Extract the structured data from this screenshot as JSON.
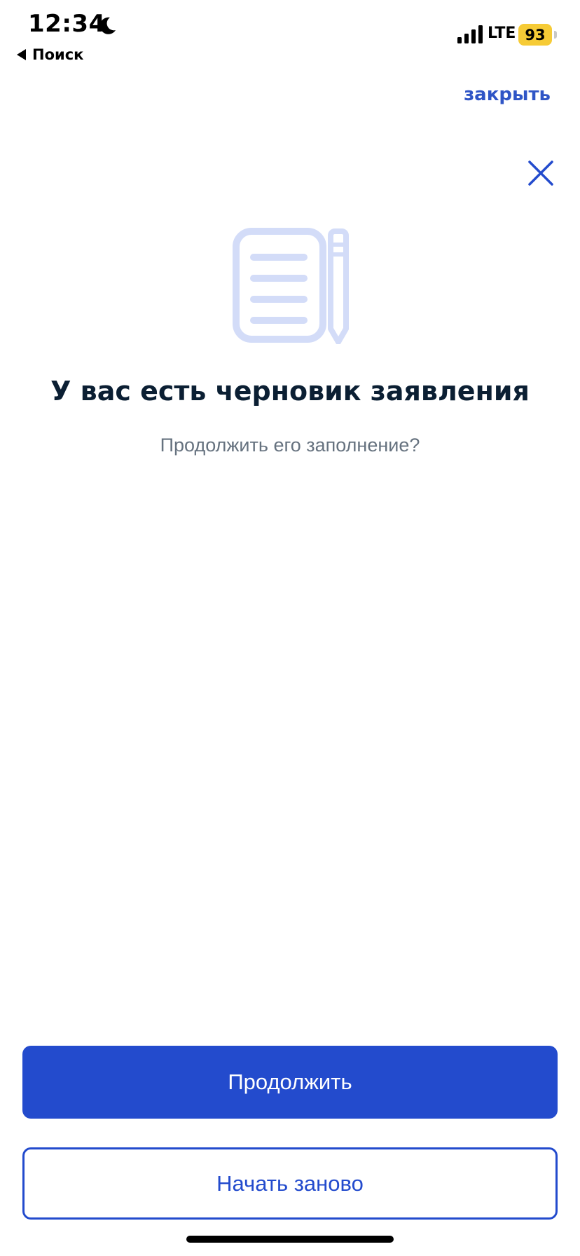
{
  "status_bar": {
    "time": "12:34",
    "back_label": "Поиск",
    "network": "LTE",
    "battery": "93"
  },
  "header": {
    "close_link": "закрыть"
  },
  "content": {
    "title": "У вас есть черновик заявления",
    "subtitle": "Продолжить его заполнение?"
  },
  "actions": {
    "continue_label": "Продолжить",
    "restart_label": "Начать заново"
  },
  "icons": {
    "moon": "moon-icon",
    "signal": "signal-icon",
    "back": "back-arrow-icon",
    "close": "close-icon",
    "illustration": "draft-document-pencil-icon"
  },
  "colors": {
    "accent": "#234bcd",
    "link": "#2f55c6",
    "title": "#0b1f33",
    "subtitle": "#66727f",
    "illustration": "#d3dcf8",
    "battery": "#f6cb36"
  }
}
